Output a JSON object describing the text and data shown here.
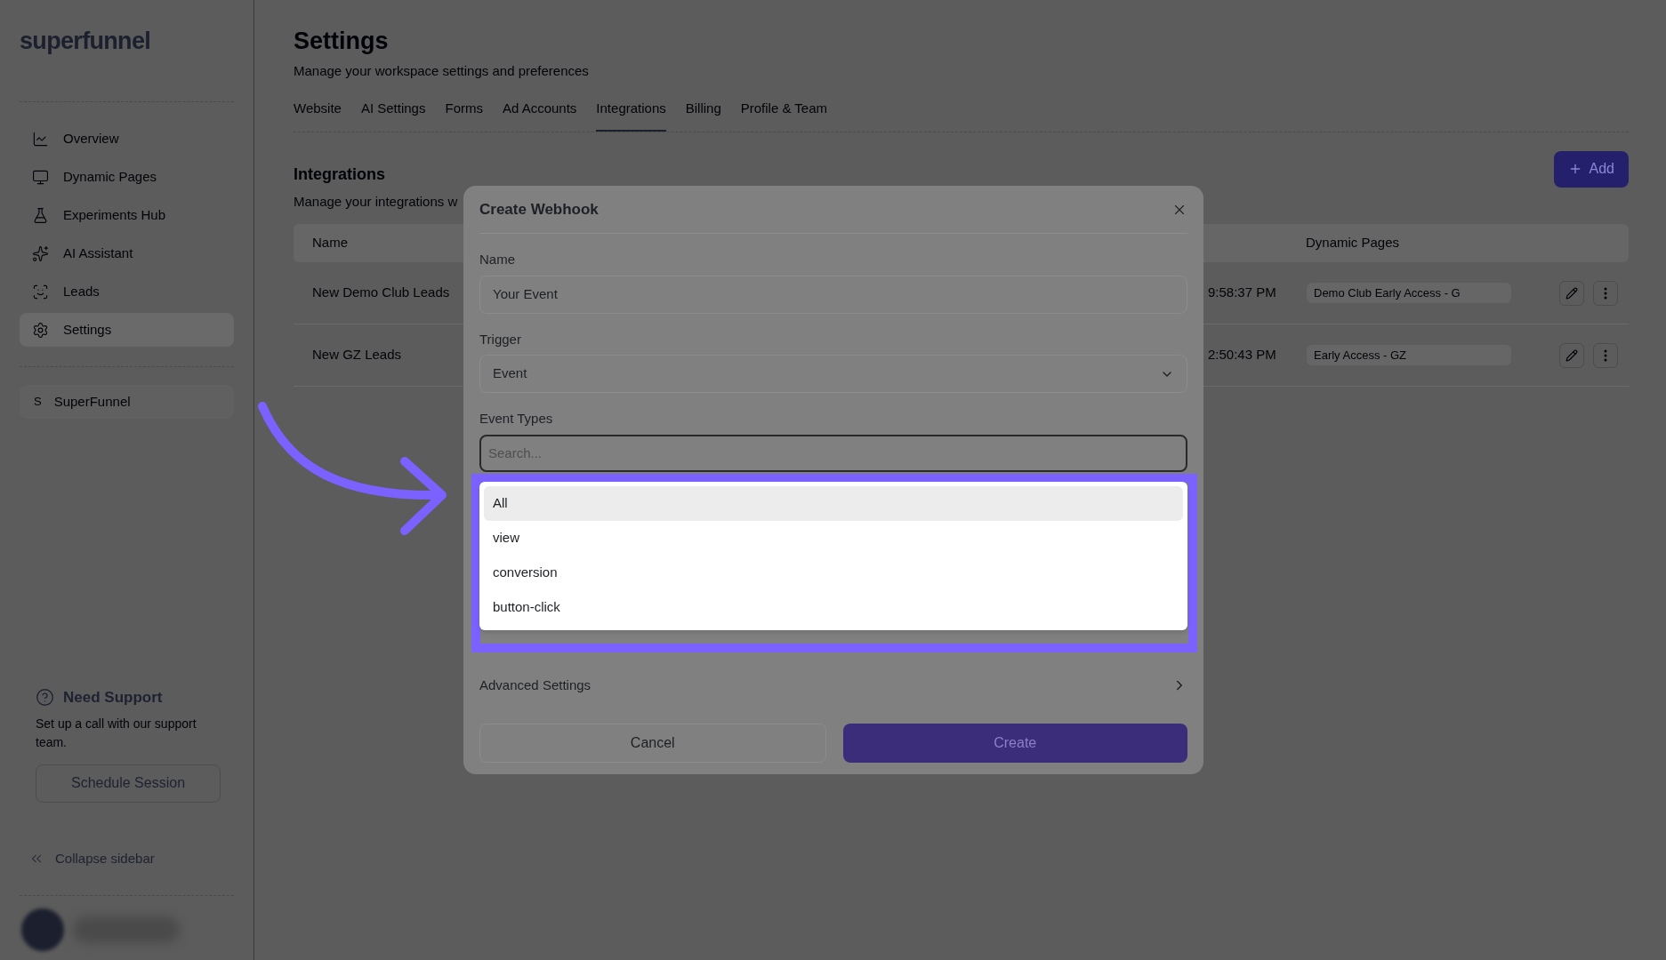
{
  "sidebar": {
    "logo": "superfunnel",
    "items": [
      {
        "label": "Overview",
        "selected": false
      },
      {
        "label": "Dynamic Pages",
        "selected": false
      },
      {
        "label": "Experiments Hub",
        "selected": false
      },
      {
        "label": "AI Assistant",
        "selected": false
      },
      {
        "label": "Leads",
        "selected": false
      },
      {
        "label": "Settings",
        "selected": true
      }
    ],
    "workspace": {
      "initial": "S",
      "name": "SuperFunnel"
    },
    "support": {
      "title": "Need Support",
      "text": "Set up a call with our support team.",
      "button": "Schedule Session"
    },
    "collapse": "Collapse sidebar"
  },
  "page": {
    "title": "Settings",
    "subtitle": "Manage your workspace settings and preferences",
    "tabs": [
      {
        "label": "Website",
        "selected": false
      },
      {
        "label": "AI Settings",
        "selected": false
      },
      {
        "label": "Forms",
        "selected": false
      },
      {
        "label": "Ad Accounts",
        "selected": false
      },
      {
        "label": "Integrations",
        "selected": true
      },
      {
        "label": "Billing",
        "selected": false
      },
      {
        "label": "Profile & Team",
        "selected": false
      }
    ],
    "section_title": "Integrations",
    "section_subtitle": "Manage your integrations w",
    "add_button": "Add",
    "table": {
      "columns": [
        "Name",
        "Dynamic Pages"
      ],
      "rows": [
        {
          "name": "New Demo Club Leads",
          "time": "9:58:37 PM",
          "page": "Demo Club Early Access - G"
        },
        {
          "name": "New GZ Leads",
          "time": "2:50:43 PM",
          "page": "Early Access - GZ"
        }
      ]
    }
  },
  "dialog": {
    "title": "Create Webhook",
    "name_label": "Name",
    "name_value": "Your Event",
    "trigger_label": "Trigger",
    "trigger_value": "Event",
    "event_types_label": "Event Types",
    "search_placeholder": "Search...",
    "options": [
      {
        "label": "All",
        "selected": true
      },
      {
        "label": "view",
        "selected": false
      },
      {
        "label": "conversion",
        "selected": false
      },
      {
        "label": "button-click",
        "selected": false
      }
    ],
    "advanced": "Advanced Settings",
    "cancel": "Cancel",
    "create": "Create"
  }
}
